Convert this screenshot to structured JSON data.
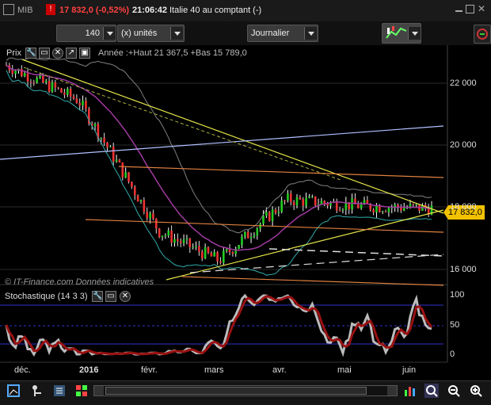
{
  "topbar": {
    "symbol": "MIB",
    "last": "17 832,0 (-0,52%)",
    "time": "21:06:42",
    "market": "Italie 40 au comptant (-)",
    "colors": {
      "down": "#ff4040"
    }
  },
  "controls": {
    "units_value": "140",
    "units_label": "(x) unités",
    "period": "Journalier"
  },
  "price_pane": {
    "title": "Prix",
    "info": "Année :+Haut 21 367,5 +Bas 15 789,0",
    "watermark": "© IT-Finance.com  Données indicatives",
    "last_label": "17 832,0",
    "y_ticks": [
      "22 000",
      "20 000",
      "18 000",
      "16 000"
    ]
  },
  "stoch_pane": {
    "title": "Stochastique (14 3 3)",
    "y_ticks": [
      "100",
      "50",
      "0"
    ]
  },
  "x_axis": [
    "déc.",
    "2016",
    "févr.",
    "mars",
    "avr.",
    "mai",
    "juin"
  ],
  "chart_data": {
    "type": "line",
    "title": "MIB",
    "ylim": [
      15500,
      22800
    ],
    "series": [
      {
        "name": "close",
        "x": [
          "déc.",
          "2016",
          "févr.",
          "mars",
          "avr.",
          "mai",
          "juin"
        ],
        "values": [
          22300,
          21200,
          17100,
          16200,
          18100,
          17900,
          17832
        ]
      }
    ]
  }
}
